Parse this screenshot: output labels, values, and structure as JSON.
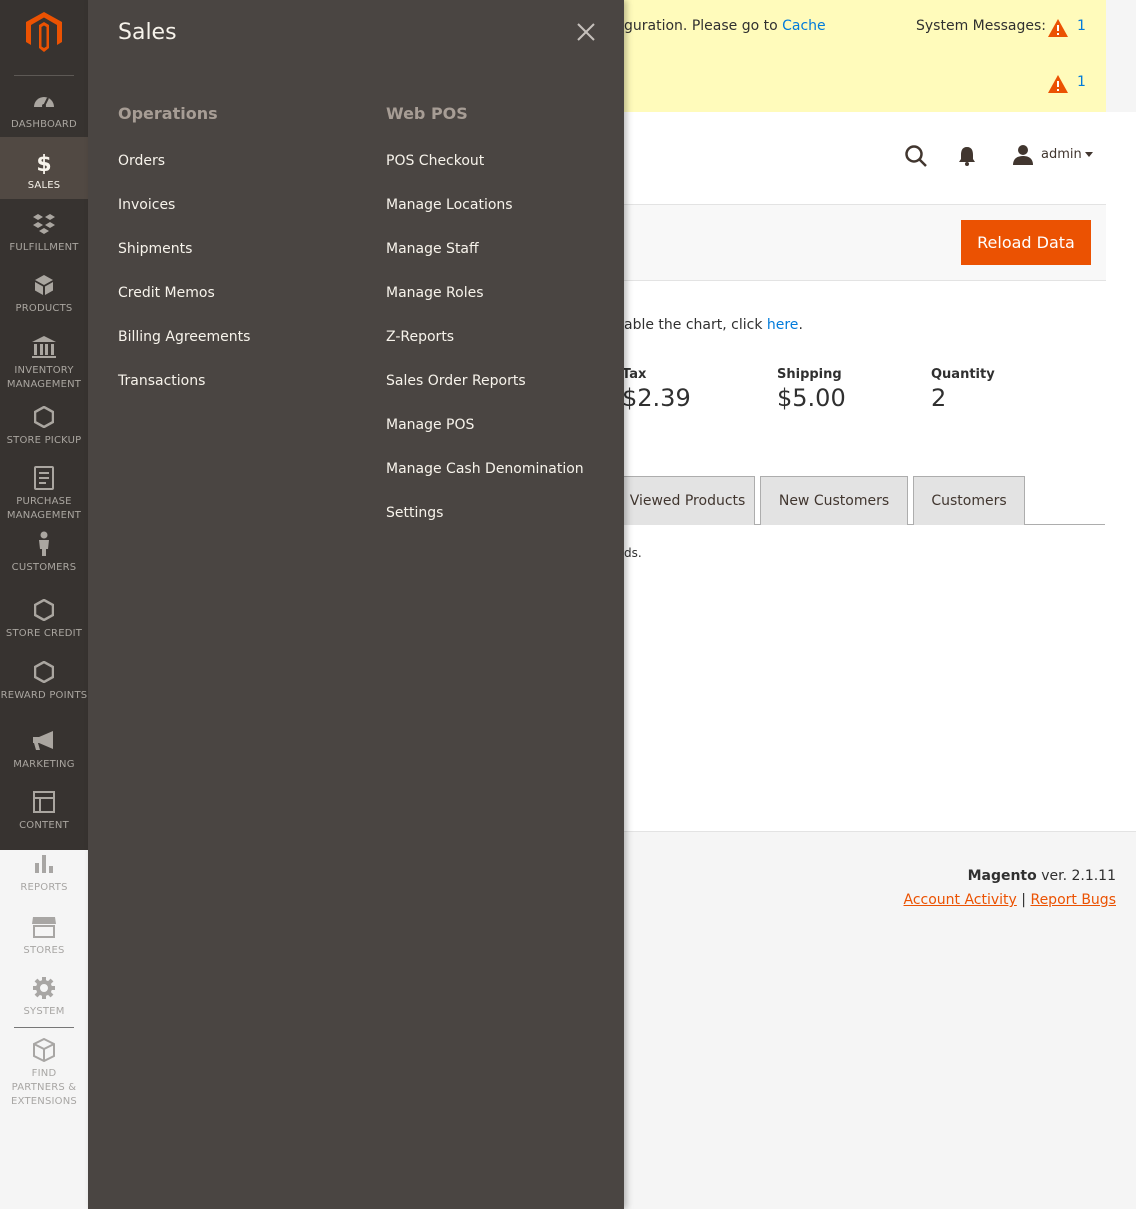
{
  "nav": {
    "items": [
      {
        "name": "dashboard",
        "label": "Dashboard",
        "icon": "dashboard-icon"
      },
      {
        "name": "sales",
        "label": "Sales",
        "icon": "dollar-icon"
      },
      {
        "name": "fulfillment",
        "label": "Fulfillment",
        "icon": "boxes-icon"
      },
      {
        "name": "products",
        "label": "Products",
        "icon": "cube-icon"
      },
      {
        "name": "inventory",
        "label": "Inventory Management",
        "icon": "warehouse-icon"
      },
      {
        "name": "store-pickup",
        "label": "Store Pickup",
        "icon": "hexagon-icon"
      },
      {
        "name": "purchase",
        "label": "Purchase Management",
        "icon": "document-icon"
      },
      {
        "name": "customers",
        "label": "Customers",
        "icon": "person-icon"
      },
      {
        "name": "store-credit",
        "label": "Store Credit",
        "icon": "hexagon-icon"
      },
      {
        "name": "reward-points",
        "label": "Reward Points",
        "icon": "hexagon-icon"
      },
      {
        "name": "marketing",
        "label": "Marketing",
        "icon": "megaphone-icon"
      },
      {
        "name": "content",
        "label": "Content",
        "icon": "layout-icon"
      },
      {
        "name": "reports",
        "label": "Reports",
        "icon": "bar-chart-icon"
      },
      {
        "name": "stores",
        "label": "Stores",
        "icon": "storefront-icon"
      },
      {
        "name": "system",
        "label": "System",
        "icon": "gear-icon"
      },
      {
        "name": "partners",
        "label": "Find Partners & Extensions",
        "icon": "cubes-icon"
      }
    ]
  },
  "flyout": {
    "title": "Sales",
    "columns": [
      {
        "heading": "Operations",
        "links": [
          "Orders",
          "Invoices",
          "Shipments",
          "Credit Memos",
          "Billing Agreements",
          "Transactions"
        ]
      },
      {
        "heading": "Web POS",
        "links": [
          "POS Checkout",
          "Manage Locations",
          "Manage Staff",
          "Manage Roles",
          "Z-Reports",
          "Sales Order Reports",
          "Manage POS",
          "Manage Cash Denomination",
          "Settings"
        ]
      }
    ]
  },
  "messages": {
    "text_partial": "guration. Please go to ",
    "link": "Cache",
    "system_label": "System Messages:",
    "count_1": "1",
    "count_2": "1"
  },
  "header": {
    "user": "admin"
  },
  "actions": {
    "reload": "Reload Data"
  },
  "dashboard": {
    "chart_note_partial": "able the chart, click ",
    "chart_note_link": "here",
    "chart_note_end": ".",
    "stats": [
      {
        "label": "Tax",
        "value": "$2.39"
      },
      {
        "label": "Shipping",
        "value": "$5.00"
      },
      {
        "label": "Quantity",
        "value": "2"
      }
    ],
    "tabs": [
      "Viewed Products",
      "New Customers",
      "Customers"
    ],
    "no_records_partial": "ds."
  },
  "footer": {
    "brand": "Magento",
    "version": " ver. 2.1.11",
    "link1": "Account Activity",
    "sep": " | ",
    "link2": "Report Bugs"
  },
  "colors": {
    "accent": "#eb5202",
    "nav_bg": "#373330",
    "flyout_bg": "#4a4542",
    "link": "#007bdb",
    "message_bg": "#fffbbb"
  }
}
